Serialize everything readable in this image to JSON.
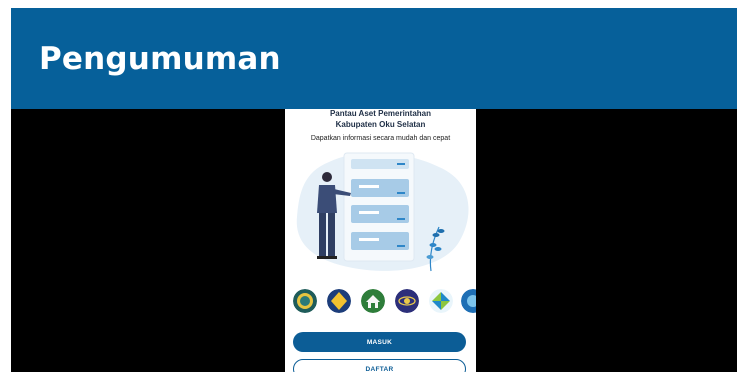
{
  "banner": {
    "title": "Pengumuman"
  },
  "app": {
    "title_line1": "Pantau Aset Pemerintahan",
    "title_line2": "Kabupaten Oku Selatan",
    "subtitle": "Dapatkan informasi secara mudah dan cepat"
  },
  "logos": [
    {
      "icon": "government-seal-icon"
    },
    {
      "icon": "yellow-emblem-icon"
    },
    {
      "icon": "housing-house-icon"
    },
    {
      "icon": "globe-emblem-icon"
    },
    {
      "icon": "green-blue-shape-icon"
    },
    {
      "icon": "partial-blue-logo-icon"
    }
  ],
  "buttons": {
    "masuk": "MASUK",
    "daftar": "DAFTAR"
  },
  "colors": {
    "banner": "#06609a",
    "primary": "#0c5d96",
    "background": "#000000"
  }
}
